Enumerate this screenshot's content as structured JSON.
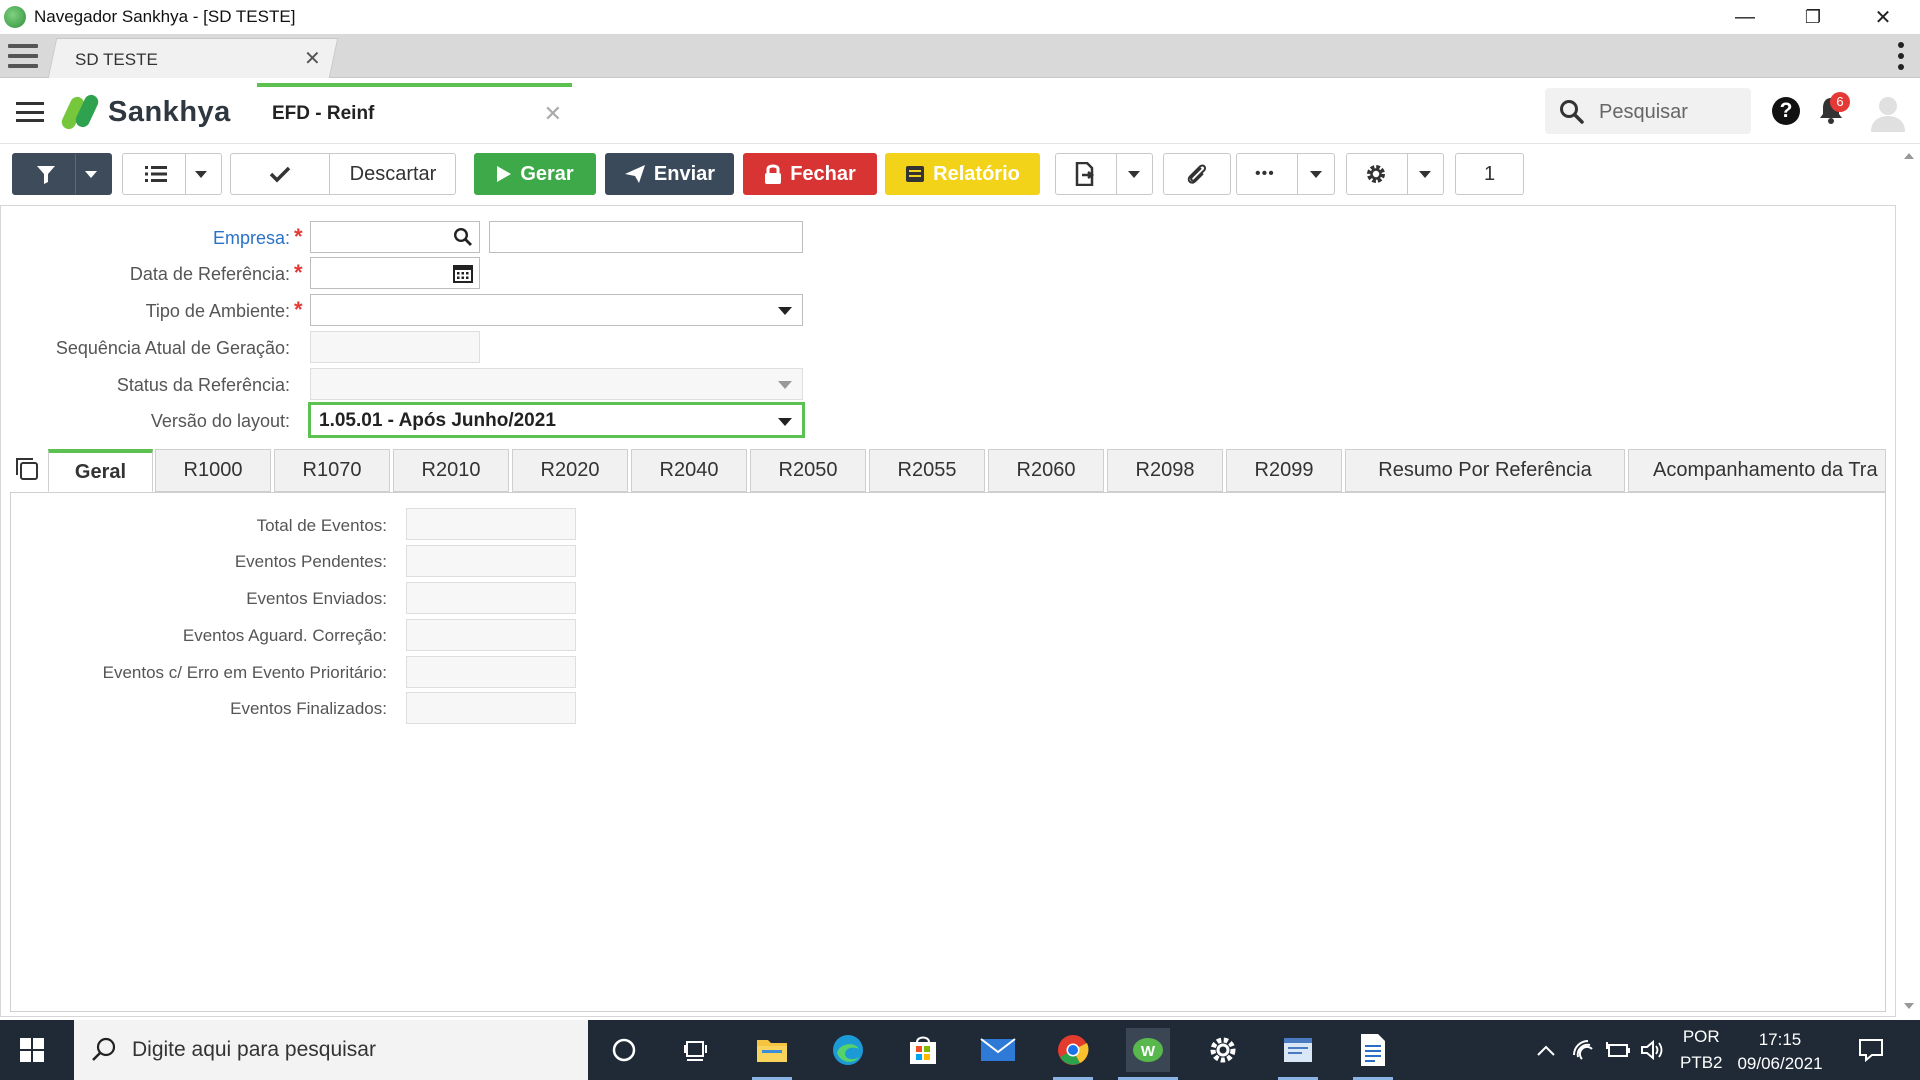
{
  "window": {
    "title": "Navegador Sankhya - [SD TESTE]",
    "minimize": "—",
    "restore": "❐",
    "close": "✕"
  },
  "browser_tab": {
    "label": "SD TESTE",
    "close": "✕"
  },
  "header": {
    "logo_text": "Sankhya",
    "screen_tab_label": "EFD - Reinf",
    "screen_tab_close": "✕",
    "search_placeholder": "Pesquisar",
    "help": "?",
    "notifications_count": "6"
  },
  "toolbar": {
    "descartar": "Descartar",
    "gerar": "Gerar",
    "enviar": "Enviar",
    "fechar": "Fechar",
    "relatorio": "Relatório",
    "more": "•••",
    "page_number": "1"
  },
  "form": {
    "empresa_label": "Empresa:",
    "data_referencia_label": "Data de Referência:",
    "tipo_ambiente_label": "Tipo de Ambiente:",
    "sequencia_label": "Sequência Atual de Geração:",
    "status_label": "Status da Referência:",
    "versao_label": "Versão do layout:",
    "versao_value": "1.05.01 - Após Junho/2021",
    "required_mark": "*"
  },
  "tabs": [
    {
      "label": "Geral",
      "active": true
    },
    {
      "label": "R1000"
    },
    {
      "label": "R1070"
    },
    {
      "label": "R2010"
    },
    {
      "label": "R2020"
    },
    {
      "label": "R2040"
    },
    {
      "label": "R2050"
    },
    {
      "label": "R2055"
    },
    {
      "label": "R2060"
    },
    {
      "label": "R2098"
    },
    {
      "label": "R2099"
    },
    {
      "label": "Resumo Por Referência"
    },
    {
      "label": "Acompanhamento da Tra"
    }
  ],
  "geral": {
    "total_eventos": "Total de Eventos:",
    "eventos_pendentes": "Eventos Pendentes:",
    "eventos_enviados": "Eventos Enviados:",
    "eventos_aguard": "Eventos Aguard. Correção:",
    "eventos_erro": "Eventos c/ Erro em Evento Prioritário:",
    "eventos_finalizados": "Eventos Finalizados:"
  },
  "taskbar": {
    "search_placeholder": "Digite aqui para pesquisar",
    "lang_top": "POR",
    "lang_bottom": "PTB2",
    "time": "17:15",
    "date": "09/06/2021"
  },
  "colors": {
    "accent_green": "#5cc151",
    "gerar_green": "#3ea948",
    "fechar_red": "#d93434",
    "relatorio_yellow": "#f3d21a",
    "navy": "#3a4a5a",
    "required_red": "#e53935",
    "label_blue": "#2a72c8"
  }
}
